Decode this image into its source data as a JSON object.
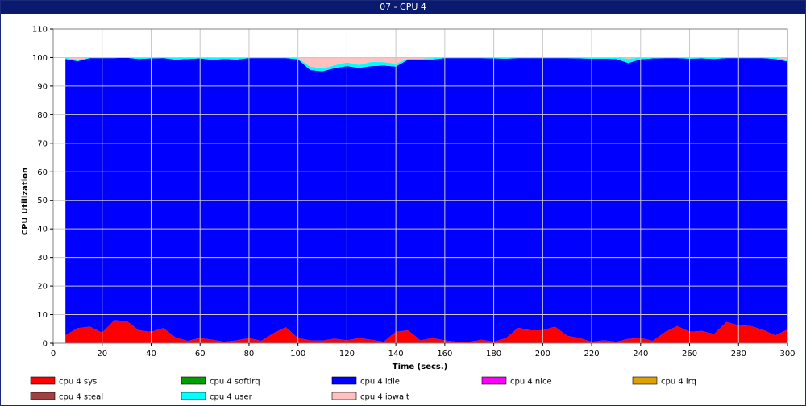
{
  "window": {
    "title": "07 - CPU 4"
  },
  "chart_data": {
    "type": "area",
    "stacked": true,
    "xlabel": "Time (secs.)",
    "ylabel": "CPU Utilization",
    "xlim": [
      0,
      300
    ],
    "ylim": [
      0,
      110
    ],
    "xticks": [
      0,
      20,
      40,
      60,
      80,
      100,
      120,
      140,
      160,
      180,
      200,
      220,
      240,
      260,
      280,
      300
    ],
    "yticks": [
      0,
      10,
      20,
      30,
      40,
      50,
      60,
      70,
      80,
      90,
      100,
      110
    ],
    "grid": true,
    "legend_position": "bottom",
    "x": [
      5,
      10,
      15,
      20,
      25,
      30,
      35,
      40,
      45,
      50,
      55,
      60,
      65,
      70,
      75,
      80,
      85,
      90,
      95,
      100,
      105,
      110,
      115,
      120,
      125,
      130,
      135,
      140,
      145,
      150,
      155,
      160,
      165,
      170,
      175,
      180,
      185,
      190,
      195,
      200,
      205,
      210,
      215,
      220,
      225,
      230,
      235,
      240,
      245,
      250,
      255,
      260,
      265,
      270,
      275,
      280,
      285,
      290,
      295,
      300
    ],
    "series": [
      {
        "name": "cpu 4 sys",
        "color": "#ff0000",
        "values": [
          2.8,
          5.3,
          5.8,
          3.7,
          8.0,
          7.8,
          4.5,
          4.0,
          5.3,
          2.0,
          0.8,
          1.8,
          1.2,
          0.5,
          1.0,
          1.8,
          0.8,
          3.5,
          5.6,
          1.8,
          1.0,
          0.9,
          1.6,
          1.0,
          1.8,
          1.2,
          0.5,
          4.0,
          4.5,
          1.0,
          1.8,
          1.0,
          0.5,
          0.5,
          1.2,
          0.5,
          1.8,
          5.4,
          4.5,
          4.5,
          5.8,
          2.6,
          1.8,
          0.5,
          1.0,
          0.5,
          1.5,
          1.8,
          0.8,
          3.9,
          6.0,
          4.0,
          4.3,
          3.2,
          7.4,
          6.3,
          6.0,
          4.7,
          2.7,
          4.8
        ]
      },
      {
        "name": "cpu 4 softirq",
        "color": "#00a000",
        "values": [
          0,
          0,
          0,
          0,
          0,
          0,
          0,
          0,
          0,
          0,
          0,
          0,
          0,
          0,
          0,
          0,
          0,
          0,
          0,
          0,
          0,
          0,
          0,
          0,
          0,
          0,
          0,
          0,
          0,
          0,
          0,
          0,
          0,
          0,
          0,
          0,
          0,
          0,
          0,
          0,
          0,
          0,
          0,
          0,
          0,
          0,
          0,
          0,
          0,
          0,
          0,
          0,
          0,
          0,
          0,
          0,
          0,
          0,
          0,
          0
        ]
      },
      {
        "name": "cpu 4 idle",
        "color": "#0000ff",
        "values": [
          96.7,
          93.4,
          94.0,
          96.1,
          91.8,
          92.1,
          95.0,
          95.7,
          94.5,
          97.3,
          98.7,
          97.9,
          98.0,
          99.0,
          98.3,
          98.0,
          99.0,
          96.3,
          94.2,
          97.6,
          94.6,
          94.3,
          94.7,
          96.0,
          94.6,
          95.8,
          96.7,
          92.8,
          94.8,
          98.2,
          97.5,
          98.8,
          99.3,
          99.3,
          98.6,
          99.2,
          97.8,
          94.4,
          95.3,
          95.3,
          94.0,
          97.2,
          97.9,
          99.1,
          98.6,
          99.0,
          96.6,
          97.6,
          98.9,
          95.9,
          93.8,
          95.6,
          95.4,
          96.3,
          92.4,
          93.5,
          93.8,
          95.1,
          96.8,
          93.8
        ]
      },
      {
        "name": "cpu 4 nice",
        "color": "#ff00ff",
        "values": [
          0,
          0,
          0,
          0,
          0,
          0,
          0,
          0,
          0,
          0,
          0,
          0,
          0,
          0,
          0,
          0,
          0,
          0,
          0,
          0,
          0,
          0,
          0,
          0,
          0,
          0,
          0,
          0,
          0,
          0,
          0,
          0,
          0,
          0,
          0,
          0,
          0,
          0,
          0,
          0,
          0,
          0,
          0,
          0,
          0,
          0,
          0,
          0,
          0,
          0,
          0,
          0,
          0,
          0,
          0,
          0,
          0,
          0,
          0,
          0
        ]
      },
      {
        "name": "cpu 4 irq",
        "color": "#e0a000",
        "values": [
          0,
          0,
          0,
          0,
          0,
          0,
          0,
          0,
          0,
          0,
          0,
          0,
          0,
          0,
          0,
          0,
          0,
          0,
          0,
          0,
          0,
          0,
          0,
          0,
          0,
          0,
          0,
          0,
          0,
          0,
          0,
          0,
          0,
          0,
          0,
          0,
          0,
          0,
          0,
          0,
          0,
          0,
          0,
          0,
          0,
          0,
          0,
          0,
          0,
          0,
          0,
          0,
          0,
          0,
          0,
          0,
          0,
          0,
          0,
          0
        ]
      },
      {
        "name": "cpu 4 steal",
        "color": "#a04040",
        "values": [
          0,
          0,
          0,
          0,
          0,
          0,
          0,
          0,
          0,
          0,
          0,
          0,
          0,
          0,
          0,
          0,
          0,
          0,
          0,
          0,
          0,
          0,
          0,
          0,
          0,
          0,
          0,
          0,
          0,
          0,
          0,
          0,
          0,
          0,
          0,
          0,
          0,
          0,
          0,
          0,
          0,
          0,
          0,
          0,
          0,
          0,
          0,
          0,
          0,
          0,
          0,
          0,
          0,
          0,
          0,
          0,
          0,
          0,
          0,
          0
        ]
      },
      {
        "name": "cpu 4 user",
        "color": "#00ffff",
        "values": [
          0.4,
          0.6,
          0.2,
          0.2,
          0.2,
          0.1,
          0.5,
          0.3,
          0.2,
          0.6,
          0.5,
          0.3,
          0.7,
          0.5,
          0.7,
          0.2,
          0.2,
          0.2,
          0.2,
          0.4,
          1.2,
          1.0,
          1.0,
          1.3,
          1.0,
          1.5,
          1.2,
          1.0,
          0.3,
          0.4,
          0.5,
          0.2,
          0.2,
          0.2,
          0.2,
          0.3,
          0.4,
          0.2,
          0.2,
          0.2,
          0.2,
          0.2,
          0.3,
          0.4,
          0.4,
          0.5,
          1.5,
          0.6,
          0.3,
          0.2,
          0.2,
          0.4,
          0.3,
          0.5,
          0.2,
          0.2,
          0.2,
          0.2,
          0.5,
          0.6
        ]
      },
      {
        "name": "cpu 4 iowait",
        "color": "#ffc0c0",
        "values": [
          0.1,
          0.7,
          0,
          0,
          0,
          0,
          0,
          0,
          0,
          0.1,
          0,
          0,
          0.1,
          0,
          0,
          0,
          0,
          0,
          0,
          0.2,
          3.2,
          3.8,
          2.7,
          1.7,
          2.6,
          1.5,
          1.6,
          2.2,
          0.4,
          0.4,
          0.2,
          0,
          0,
          0,
          0,
          0,
          0,
          0,
          0,
          0,
          0,
          0,
          0,
          0,
          0,
          0,
          0.4,
          0,
          0,
          0,
          0,
          0,
          0,
          0,
          0,
          0,
          0,
          0,
          0,
          0.8
        ]
      }
    ]
  }
}
